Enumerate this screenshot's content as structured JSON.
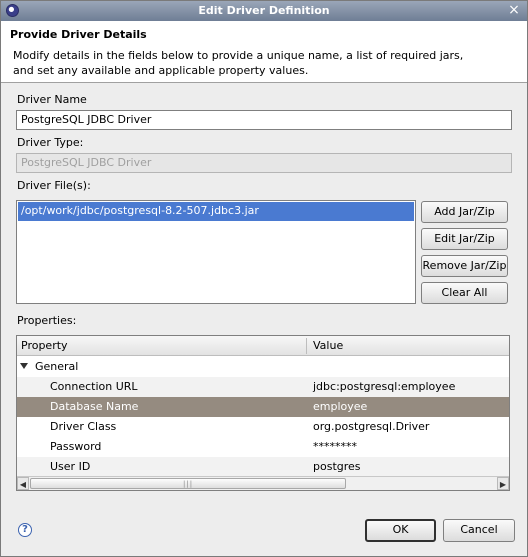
{
  "window": {
    "title": "Edit Driver Definition",
    "close_glyph": "×"
  },
  "banner": {
    "heading": "Provide Driver Details",
    "description": "Modify details in the fields below to provide a unique name, a list of required jars, and set any available and applicable property values."
  },
  "driver_name": {
    "label": "Driver Name",
    "value": "PostgreSQL JDBC Driver"
  },
  "driver_type": {
    "label": "Driver Type:",
    "value": "PostgreSQL JDBC Driver"
  },
  "driver_files": {
    "label": "Driver File(s):",
    "items": [
      "/opt/work/jdbc/postgresql-8.2-507.jdbc3.jar"
    ]
  },
  "jar_buttons": {
    "add": "Add Jar/Zip",
    "edit": "Edit Jar/Zip",
    "remove": "Remove Jar/Zip",
    "clear": "Clear All"
  },
  "properties": {
    "label": "Properties:",
    "columns": [
      "Property",
      "Value"
    ],
    "group": "General",
    "rows": [
      {
        "property": "Connection URL",
        "value": "jdbc:postgresql:employee"
      },
      {
        "property": "Database Name",
        "value": "employee"
      },
      {
        "property": "Driver Class",
        "value": "org.postgresql.Driver"
      },
      {
        "property": "Password",
        "value": "********"
      },
      {
        "property": "User ID",
        "value": "postgres"
      }
    ],
    "scroll_grip": "|||"
  },
  "footer": {
    "help_glyph": "?",
    "ok": "OK",
    "cancel": "Cancel"
  },
  "colors": {
    "selection": "#4a7ad1",
    "selected_row": "#958b80",
    "titlebar": "#7b889c"
  }
}
